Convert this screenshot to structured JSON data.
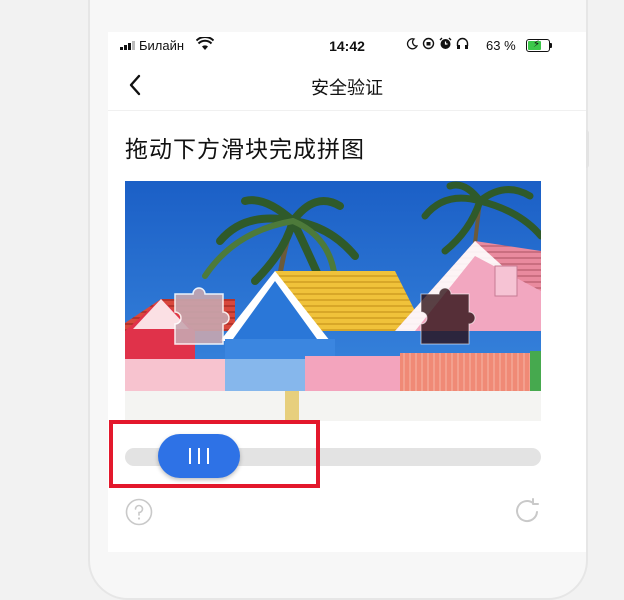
{
  "status_bar": {
    "carrier": "Билайн",
    "time": "14:42",
    "battery_percent": "63 %",
    "battery_level": 0.63,
    "icons": [
      "signal-icon",
      "wifi-icon",
      "moon-icon",
      "orientation-lock-icon",
      "alarm-icon",
      "headphones-icon",
      "battery-icon"
    ]
  },
  "nav": {
    "title": "安全验证",
    "back_icon": "chevron-left-icon"
  },
  "captcha": {
    "instruction": "拖动下方滑块完成拼图",
    "slider_handle_icon": "grip-lines-icon",
    "slider_progress": 0.1,
    "help_icon": "question-circle-icon",
    "refresh_icon": "refresh-icon"
  },
  "colors": {
    "accent": "#2e72e6",
    "highlight_box": "#e3182c",
    "track": "#e3e3e3"
  }
}
